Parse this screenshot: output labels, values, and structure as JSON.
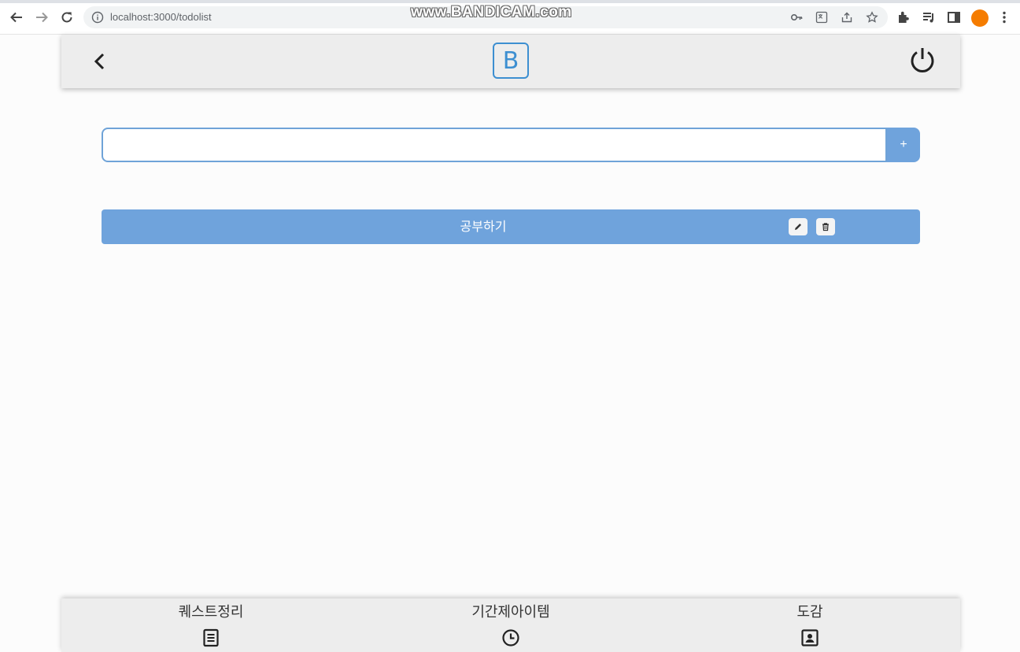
{
  "browser": {
    "url": "localhost:3000/todolist",
    "watermark": "www.BANDICAM.com"
  },
  "header": {
    "logo_letter": "B",
    "back_icon": "chevron-left-icon",
    "power_icon": "power-icon"
  },
  "todo_form": {
    "input_value": "",
    "add_label": "+"
  },
  "todos": [
    {
      "text": "공부하기"
    }
  ],
  "bottom_nav": {
    "items": [
      {
        "label": "퀘스트정리",
        "icon": "list-icon"
      },
      {
        "label": "기간제아이템",
        "icon": "clock-icon"
      },
      {
        "label": "도감",
        "icon": "contact-book-icon"
      }
    ]
  },
  "colors": {
    "accent": "#6fa3dc",
    "logo": "#3d8fd1",
    "bar": "#ededed"
  }
}
